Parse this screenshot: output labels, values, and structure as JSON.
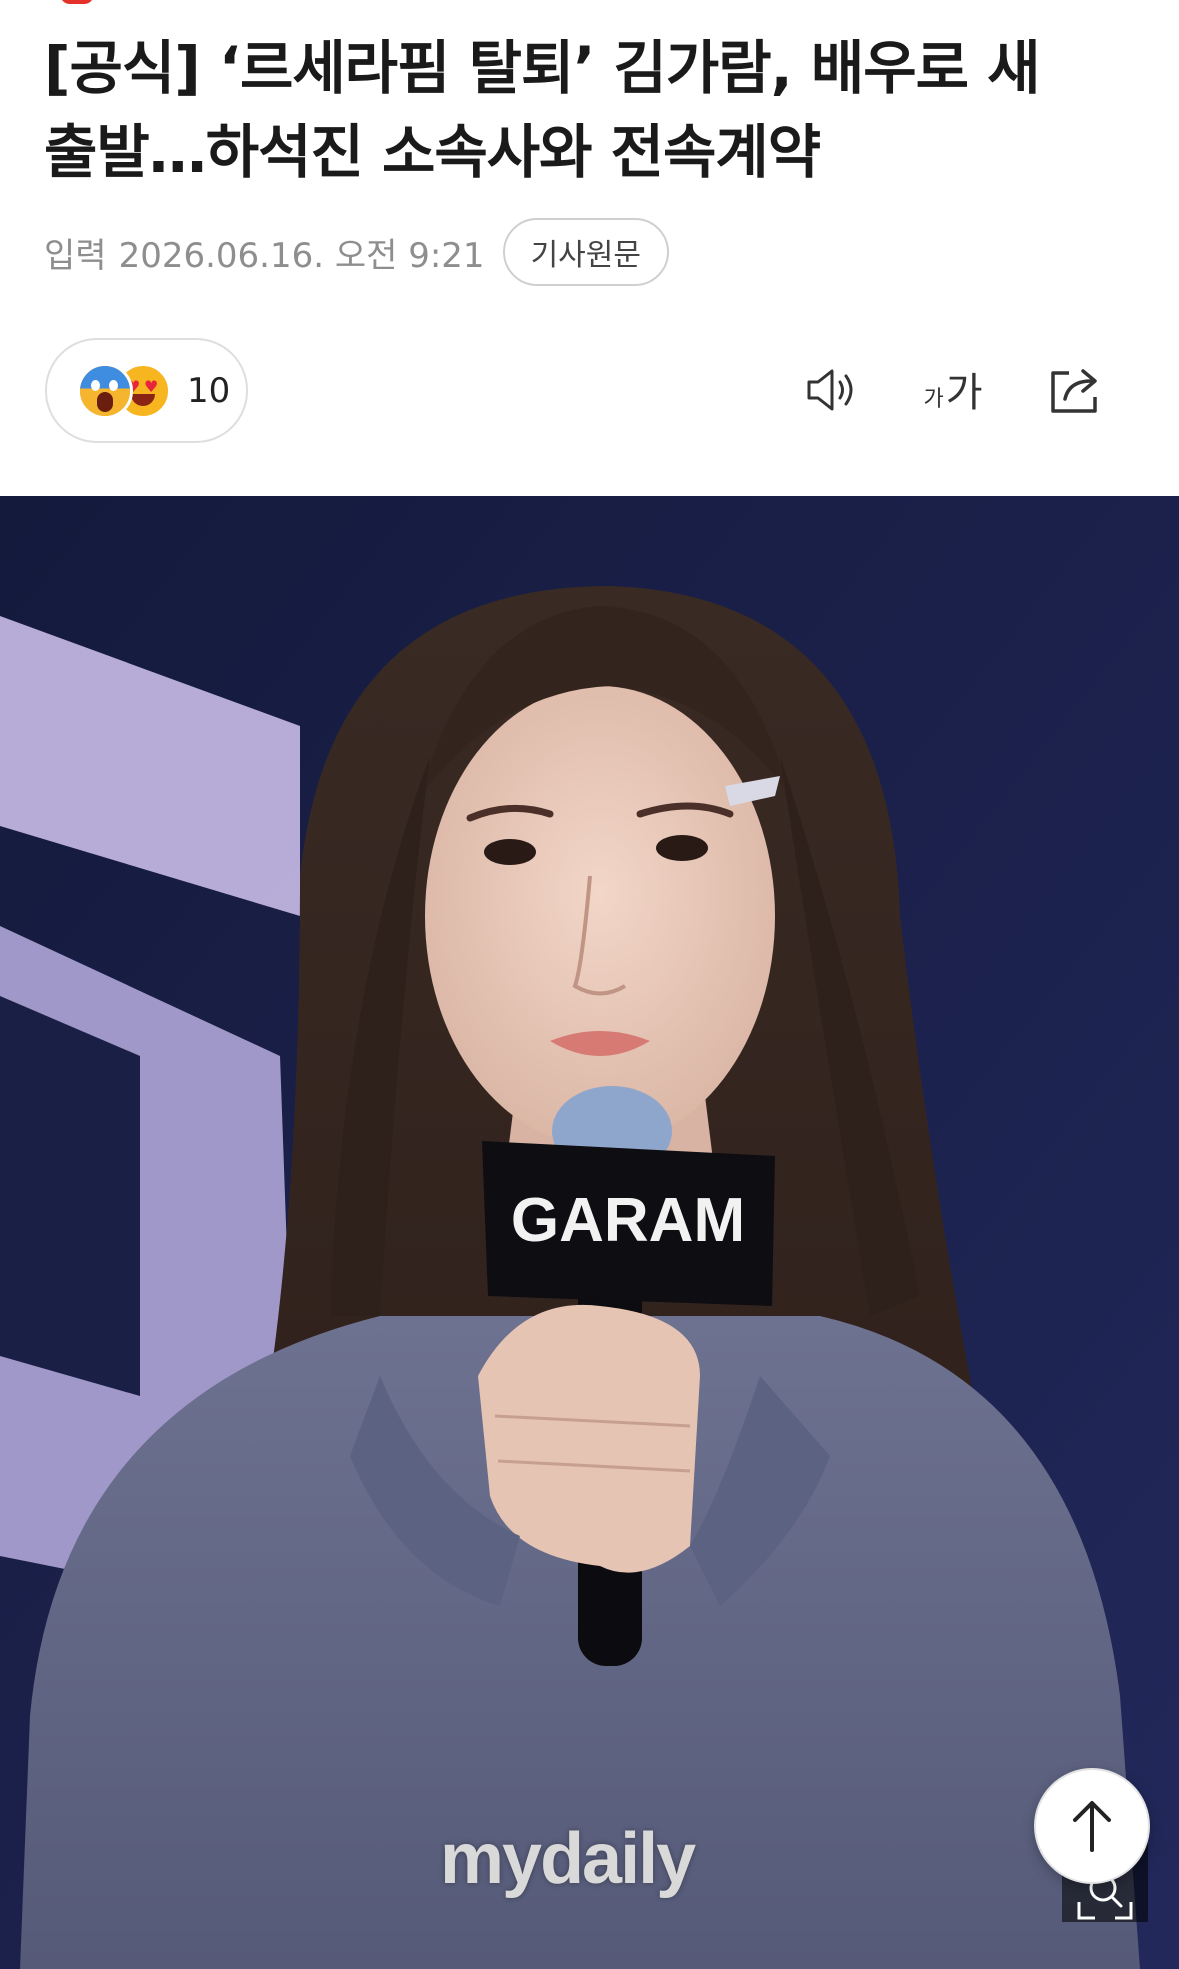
{
  "article": {
    "title_line1": "[공식] ‘르세라핌 탈퇴’ 김가람, 배우로 새",
    "title_line2": "출발…하석진 소속사와 전속계약",
    "input_label": "입력",
    "date": "2026.06.16. 오전 9:21",
    "source_button": "기사원문"
  },
  "reactions": {
    "count": "10",
    "emojis": [
      "shocked-emoji",
      "heart-eyes-emoji"
    ]
  },
  "toolbar": {
    "icons": [
      "speaker-icon",
      "font-size-icon",
      "share-icon"
    ],
    "font_size_small": "가",
    "font_size_large": "가"
  },
  "photo": {
    "mic_label": "GARAM",
    "watermark": "mydaily"
  },
  "floating": {
    "icons": [
      "zoom-icon",
      "scroll-to-top-icon"
    ]
  },
  "colors": {
    "accent_red": "#e4322b",
    "stage_navy": "#1c2248",
    "stage_lavender": "#c9bde8"
  }
}
